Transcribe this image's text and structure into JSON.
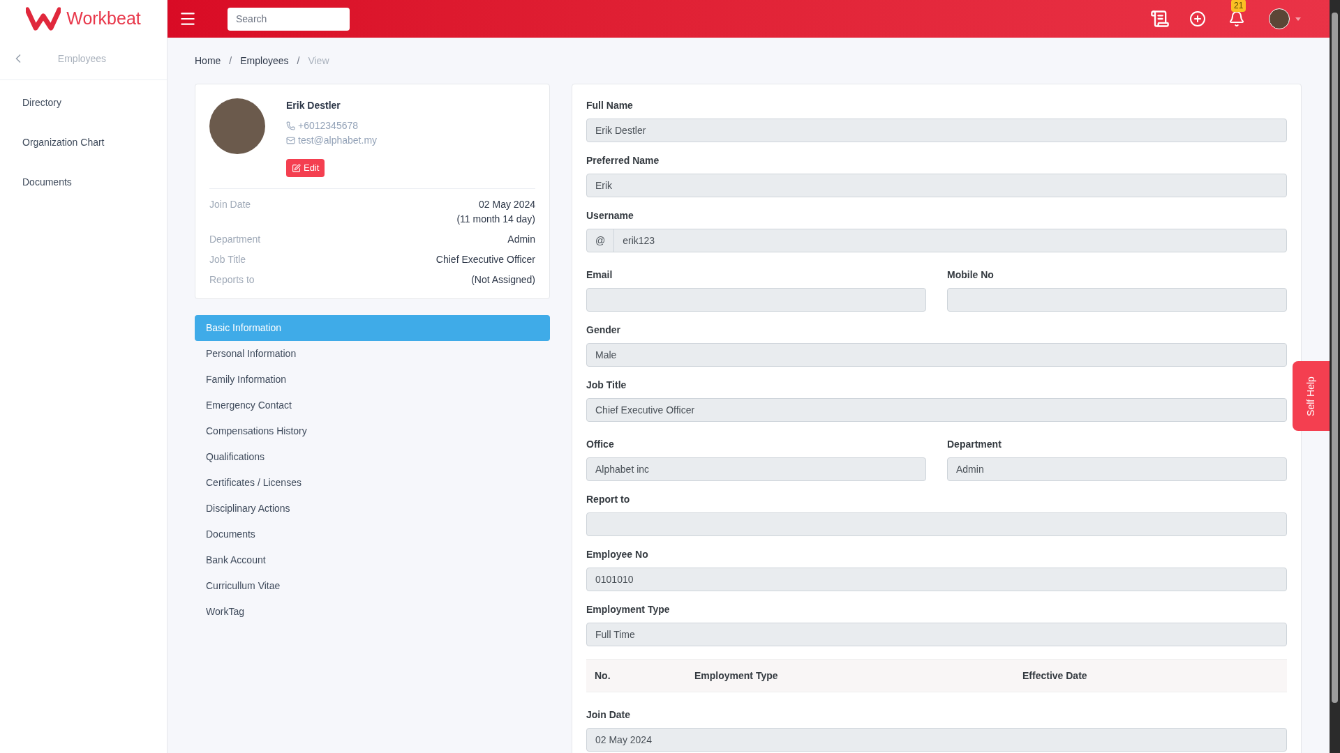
{
  "brand": {
    "name": "Workbeat"
  },
  "header": {
    "search": {
      "placeholder": "Search"
    },
    "notifications": {
      "count": "21"
    }
  },
  "sidebar": {
    "back_title": "Employees",
    "items": [
      {
        "label": "Directory",
        "selected": false
      },
      {
        "label": "Organization Chart",
        "selected": false
      },
      {
        "label": "Documents",
        "selected": false
      }
    ]
  },
  "breadcrumb_separator": "/",
  "breadcrumb": [
    {
      "label": "Home",
      "current": false
    },
    {
      "label": "Employees",
      "current": false
    },
    {
      "label": "View",
      "current": true
    }
  ],
  "profile": {
    "name": "Erik Destler",
    "phone": "+6012345678",
    "email": "test@alphabet.my",
    "edit_button": "Edit",
    "details": [
      {
        "label": "Join Date",
        "value": "02 May 2024",
        "note": "(11 month 14 day)"
      },
      {
        "label": "Department",
        "value": "Admin"
      },
      {
        "label": "Job Title",
        "value": "Chief Executive Officer"
      },
      {
        "label": "Reports to",
        "value": "(Not Assigned)"
      }
    ]
  },
  "sections": [
    {
      "label": "Basic Information",
      "selected": true
    },
    {
      "label": "Personal Information",
      "selected": false
    },
    {
      "label": "Family Information",
      "selected": false
    },
    {
      "label": "Emergency Contact",
      "selected": false
    },
    {
      "label": "Compensations History",
      "selected": false
    },
    {
      "label": "Qualifications",
      "selected": false
    },
    {
      "label": "Certificates / Licenses",
      "selected": false
    },
    {
      "label": "Disciplinary Actions",
      "selected": false
    },
    {
      "label": "Documents",
      "selected": false
    },
    {
      "label": "Bank Account",
      "selected": false
    },
    {
      "label": "Curricullum Vitae",
      "selected": false
    },
    {
      "label": "WorkTag",
      "selected": false
    }
  ],
  "form": [
    {
      "kind": "field",
      "label": "Full Name",
      "value": "Erik Destler"
    },
    {
      "kind": "field",
      "label": "Preferred Name",
      "value": "Erik"
    },
    {
      "kind": "addon",
      "label": "Username",
      "prefix": "@",
      "value": "erik123"
    },
    {
      "kind": "pair",
      "fields": [
        {
          "label": "Email"
        },
        {
          "label": "Mobile No"
        }
      ]
    },
    {
      "kind": "field",
      "label": "Gender",
      "value": "Male"
    },
    {
      "kind": "field",
      "label": "Job Title",
      "value": "Chief Executive Officer"
    },
    {
      "kind": "pair",
      "fields": [
        {
          "label": "Office",
          "value": "Alphabet inc"
        },
        {
          "label": "Department",
          "value": "Admin"
        }
      ]
    },
    {
      "kind": "field",
      "label": "Report to"
    },
    {
      "kind": "field",
      "label": "Employee No",
      "value": "0101010"
    },
    {
      "kind": "field",
      "label": "Employment Type",
      "value": "Full Time"
    },
    {
      "kind": "table",
      "columns": [
        "No.",
        "Employment Type",
        "Effective Date"
      ]
    },
    {
      "kind": "field",
      "label": "Join Date",
      "value": "02 May 2024"
    }
  ],
  "self_help": {
    "label": "Self Help"
  }
}
